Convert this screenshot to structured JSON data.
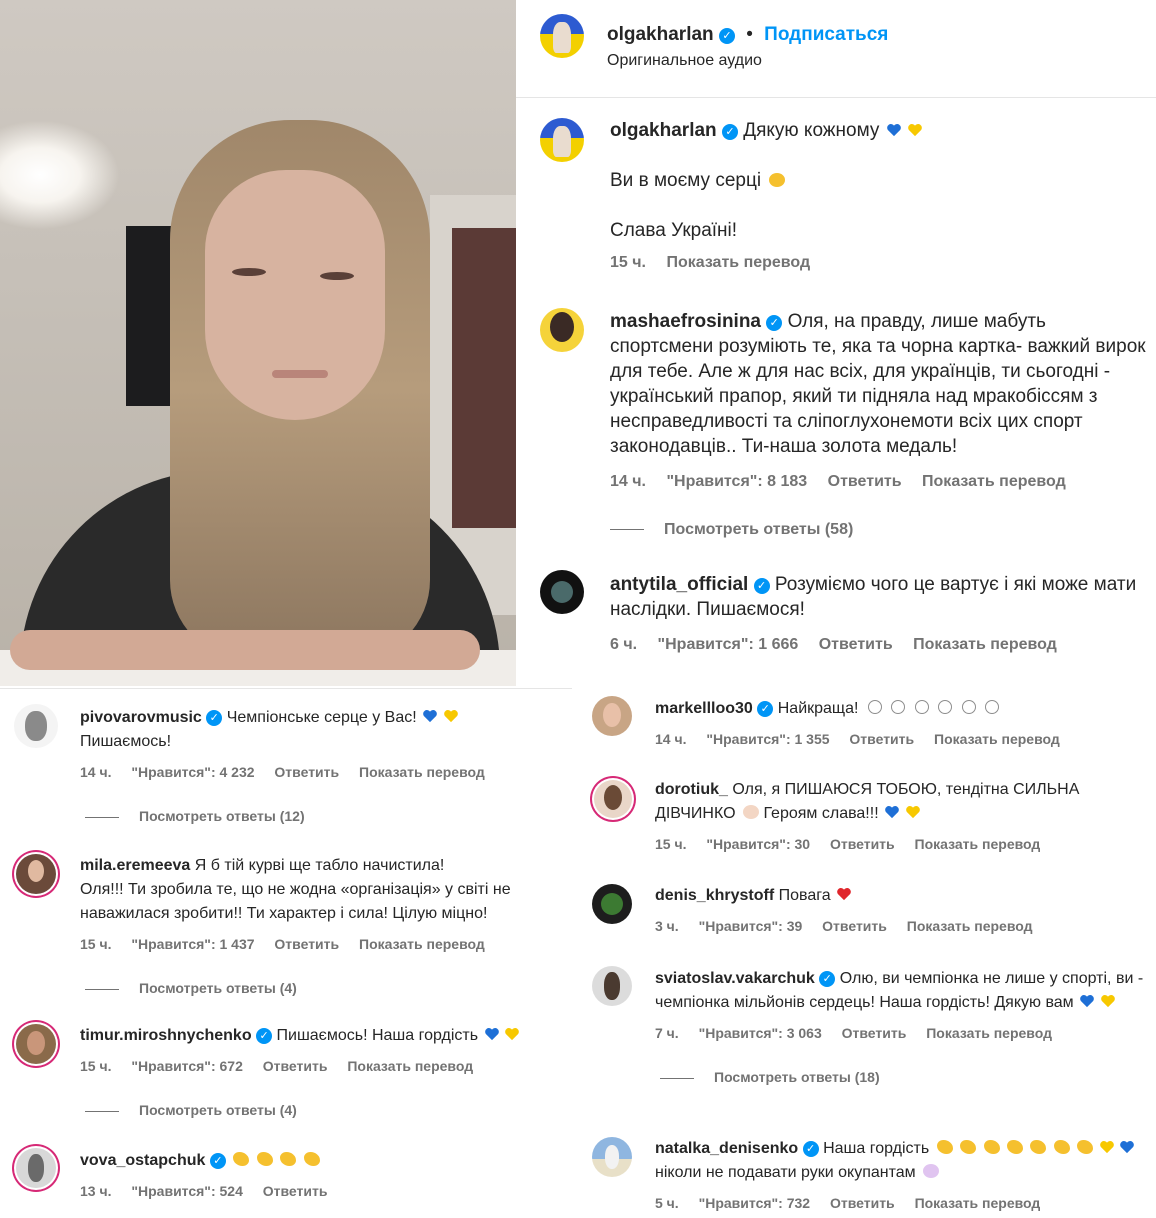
{
  "header": {
    "username": "olgakharlan",
    "follow_label": "Подписаться",
    "audio_label": "Оригинальное аудио"
  },
  "caption": {
    "username": "olgakharlan",
    "line1": "Дякую кожному",
    "line2": "Ви в моєму серці",
    "line3": "Слава Україні!",
    "time": "15 ч.",
    "translate": "Показать перевод"
  },
  "right_comments": [
    {
      "username": "mashaefrosinina",
      "text": "Оля, на правду, лише мабуть спортсмени розуміють те, яка та чорна картка- важкий вирок для тебе. Але ж для нас всіх, для українців, ти сьогодні - український прапор, який ти підняла над мракобіссям з несправедливості та сліпоглухонемоти всіх цих спорт законодавців.. Ти-наша золота медаль!",
      "time": "14 ч.",
      "likes": "\"Нравится\": 8 183",
      "reply": "Ответить",
      "translate": "Показать перевод",
      "view_replies": "Посмотреть ответы (58)"
    },
    {
      "username": "antytila_official",
      "text": "Розуміємо чого це вартує і які може мати наслідки. Пишаємося!",
      "time": "6 ч.",
      "likes": "\"Нравится\": 1 666",
      "reply": "Ответить",
      "translate": "Показать перевод"
    }
  ],
  "left_comments": [
    {
      "username": "pivovarovmusic",
      "text": "Чемпіонське серце у Вас!",
      "text2": "Пишаємось!",
      "time": "14 ч.",
      "likes": "\"Нравится\": 4 232",
      "reply": "Ответить",
      "translate": "Показать перевод",
      "view_replies": "Посмотреть ответы (12)"
    },
    {
      "username": "mila.eremeeva",
      "text": "Я б тій курві ще табло начистила!",
      "text2": "Оля!!! Ти зробила те, що не жодна «організація» у світі не наважилася зробити!! Ти характер і сила! Цілую міцно!",
      "time": "15 ч.",
      "likes": "\"Нравится\": 1 437",
      "reply": "Ответить",
      "translate": "Показать перевод",
      "view_replies": "Посмотреть ответы (4)"
    },
    {
      "username": "timur.miroshnychenko",
      "text": "Пишаємось! Наша гордість",
      "time": "15 ч.",
      "likes": "\"Нравится\": 672",
      "reply": "Ответить",
      "translate": "Показать перевод",
      "view_replies": "Посмотреть ответы (4)"
    },
    {
      "username": "vova_ostapchuk",
      "time": "13 ч.",
      "likes": "\"Нравится\": 524",
      "reply": "Ответить"
    }
  ],
  "mid_comments": [
    {
      "username": "markellloo30",
      "text": "Найкраща!",
      "time": "14 ч.",
      "likes": "\"Нравится\": 1 355",
      "reply": "Ответить",
      "translate": "Показать перевод"
    },
    {
      "username": "dorotiuk_",
      "text": "Оля, я ПИШАЮСЯ ТОБОЮ, тендітна СИЛЬНА ДІВЧИНКО",
      "text2": "Героям слава!!!",
      "time": "15 ч.",
      "likes": "\"Нравится\": 30",
      "reply": "Ответить",
      "translate": "Показать перевод"
    },
    {
      "username": "denis_khrystoff",
      "text": "Повага",
      "time": "3 ч.",
      "likes": "\"Нравится\": 39",
      "reply": "Ответить",
      "translate": "Показать перевод"
    },
    {
      "username": "sviatoslav.vakarchuk",
      "text": "Олю, ви чемпіонка не лише у спорті, ви - чемпіонка мільйонів сердець! Наша гордість! Дякую вам",
      "time": "7 ч.",
      "likes": "\"Нравится\": 3 063",
      "reply": "Ответить",
      "translate": "Показать перевод",
      "view_replies": "Посмотреть ответы (18)"
    },
    {
      "username": "natalka_denisenko",
      "text": "Наша гордість",
      "text2": "ніколи не подавати руки окупантам",
      "time": "5 ч.",
      "likes": "\"Нравится\": 732",
      "reply": "Ответить",
      "translate": "Показать перевод"
    }
  ],
  "colors": {
    "accent": "#0095f6",
    "muted": "#737373",
    "text": "#262626",
    "blue_heart": "#1e6fd6",
    "yellow_heart": "#f7c800",
    "red_heart": "#e0262c"
  },
  "icons": [
    "verified-badge-icon",
    "blue-heart-icon",
    "yellow-heart-icon",
    "red-heart-icon",
    "clapping-hands-icon",
    "outline-heart-icon"
  ]
}
